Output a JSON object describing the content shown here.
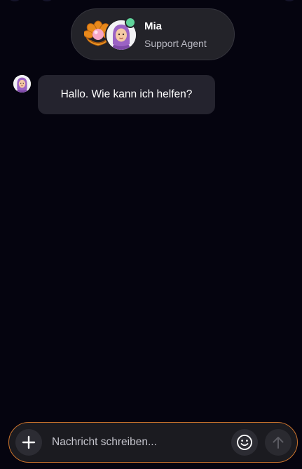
{
  "agent": {
    "name": "Mia",
    "role": "Support Agent",
    "status": "online",
    "status_color": "#5fd39a",
    "logo_icon": "pearl-shell-icon",
    "avatar_icon": "agent-avatar-icon"
  },
  "messages": [
    {
      "sender": "agent",
      "text": "Hallo. Wie kann ich helfen?"
    }
  ],
  "composer": {
    "placeholder": "Nachricht schreiben...",
    "value": "",
    "add_icon": "plus-icon",
    "emoji_icon": "smiley-icon",
    "send_icon": "arrow-up-icon",
    "border_color": "#c9722c"
  },
  "colors": {
    "background": "#05040f",
    "pill_background": "#232329",
    "bubble_background": "#24232e"
  }
}
